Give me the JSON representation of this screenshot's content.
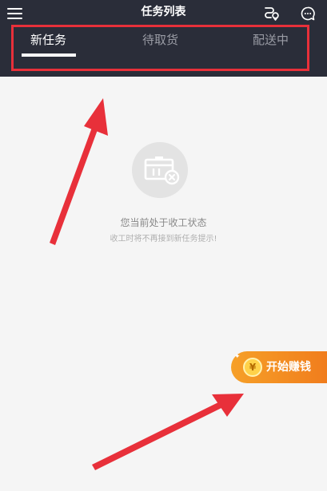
{
  "header": {
    "title": "任务列表",
    "menu_icon": "hamburger-menu-icon",
    "route_icon": "route-map-icon",
    "message_icon": "chat-bubble-icon"
  },
  "tabs": [
    {
      "label": "新任务",
      "active": true
    },
    {
      "label": "待取货",
      "active": false
    },
    {
      "label": "配送中",
      "active": false
    }
  ],
  "empty_state": {
    "icon": "box-closed-icon",
    "title": "您当前处于收工状态",
    "subtitle": "收工时将不再接到新任务提示!"
  },
  "earn_button": {
    "label": "开始赚钱",
    "coin_symbol": "¥"
  },
  "annotations": {
    "highlight_color": "#e8303a"
  }
}
